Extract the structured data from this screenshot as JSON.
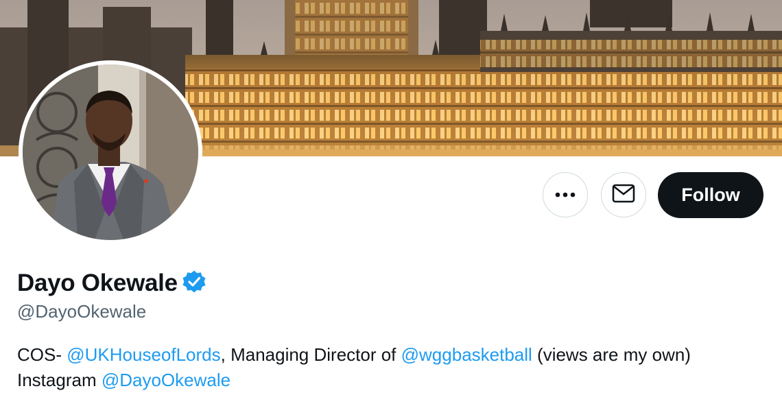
{
  "profile": {
    "display_name": "Dayo Okewale",
    "verified": true,
    "handle": "@DayoOkewale",
    "bio": {
      "line1": {
        "prefix": "COS- ",
        "mention1": "@UKHouseofLords",
        "middle": ", Managing Director of ",
        "mention2": "@wggbasketball",
        "suffix": " (views are my own)"
      },
      "line2": {
        "prefix": "Instagram ",
        "mention": "@DayoOkewale"
      }
    }
  },
  "actions": {
    "more_icon": "ellipsis-icon",
    "message_icon": "envelope-icon",
    "follow_label": "Follow"
  },
  "colors": {
    "accent": "#1d9bf0",
    "text": "#0f1419",
    "secondary_text": "#536471",
    "follow_bg": "#0f1419"
  }
}
